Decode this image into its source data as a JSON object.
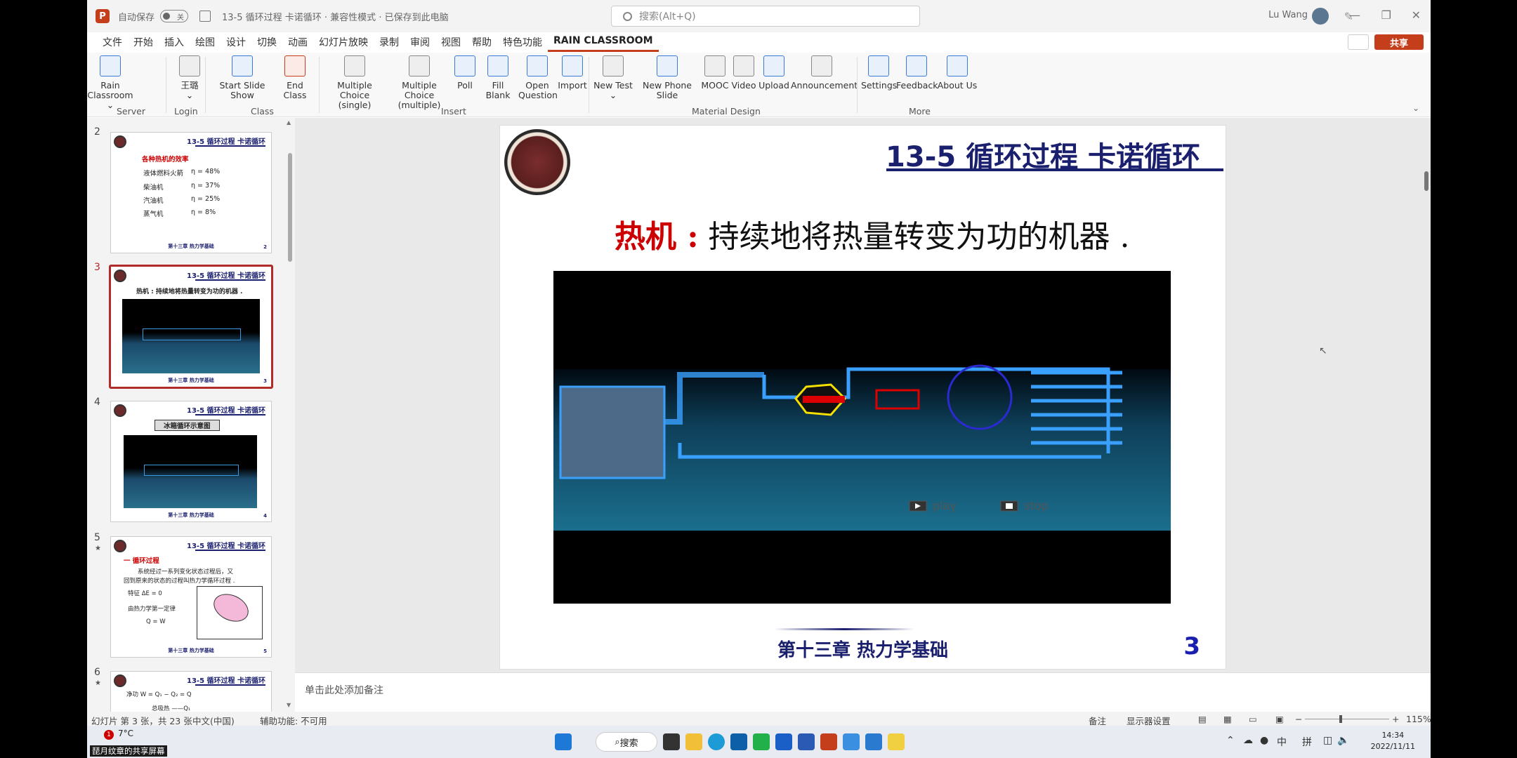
{
  "titlebar": {
    "autosave": "自动保存",
    "toggle_state": "关",
    "doc_title": "13-5 循环过程 卡诺循环 · 兼容性模式 · 已保存到此电脑",
    "search_placeholder": "搜索(Alt+Q)",
    "user_name": "Lu Wang"
  },
  "tabs": [
    "文件",
    "开始",
    "插入",
    "绘图",
    "设计",
    "切换",
    "动画",
    "幻灯片放映",
    "录制",
    "审阅",
    "视图",
    "帮助",
    "特色功能",
    "RAIN CLASSROOM"
  ],
  "active_tab": "RAIN CLASSROOM",
  "share_label": "共享",
  "ribbon": {
    "rain_classroom": "Rain Classroom",
    "login_user": "王璐",
    "start_slide_show": "Start Slide Show",
    "end_class": "End Class",
    "mc_single_1": "Multiple Choice",
    "mc_single_2": "(single)",
    "mc_multi_1": "Multiple Choice",
    "mc_multi_2": "(multiple)",
    "poll": "Poll",
    "fill_blank": "Fill Blank",
    "open_question_1": "Open",
    "open_question_2": "Question",
    "import": "Import",
    "new_test": "New Test",
    "new_phone_slide": "New Phone Slide",
    "mooc": "MOOC",
    "video": "Video",
    "upload": "Upload",
    "announcement": "Announcement",
    "settings": "Settings",
    "feedback": "Feedback",
    "about_us": "About Us",
    "groups": {
      "server": "Server",
      "login": "Login",
      "class": "Class",
      "insert": "Insert",
      "material_design": "Material Design",
      "more": "More"
    }
  },
  "thumbnails": {
    "header": "13-5 循环过程 卡诺循环",
    "footer": "第十三章 热力学基础",
    "slide2": {
      "num": "2",
      "title": "各种热机的效率",
      "rows": [
        {
          "name": "液体燃料火箭",
          "eff": "η = 48%"
        },
        {
          "name": "柴油机",
          "eff": "η = 37%"
        },
        {
          "name": "汽油机",
          "eff": "η = 25%"
        },
        {
          "name": "蒸气机",
          "eff": "η = 8%"
        }
      ]
    },
    "slide3": {
      "num": "3",
      "heading": "热机 : 持续地将热量转变为功的机器 ."
    },
    "slide4": {
      "num": "4",
      "box": "冰箱循环示意图"
    },
    "slide5": {
      "num": "5",
      "title": "一  循环过程",
      "line1": "系统经过一系列变化状态过程后，又",
      "line2": "回到原来的状态的过程叫热力学循环过程 .",
      "feature": "特征  ΔE = 0",
      "law": "由热力学第一定律",
      "eq": "Q = W"
    },
    "slide6": {
      "num": "6",
      "line1": "净功   W = Q₁ − Q₂ = Q",
      "line2": "总吸热 ——Q₁"
    }
  },
  "slide": {
    "title": "13-5 循环过程 卡诺循环",
    "heading_red": "热机 :",
    "heading_rest": " 持续地将热量转变为功的机器 .",
    "video_play": "play",
    "video_stop": "stop",
    "footer": "第十三章 热力学基础",
    "page": "3"
  },
  "notes_placeholder": "单击此处添加备注",
  "status": {
    "slide_info": "幻灯片 第 3 张，共 23 张",
    "language": "中文(中国)",
    "accessibility": "辅助功能: 不可用",
    "notes": "备注",
    "display_settings": "显示器设置",
    "zoom": "115%"
  },
  "taskbar": {
    "weather": "7°C",
    "badge": "1",
    "sharing": "琵月纹章的共享屏幕",
    "search": "搜索",
    "ime1": "中",
    "ime2": "拼",
    "time": "14:34",
    "date": "2022/11/11"
  }
}
